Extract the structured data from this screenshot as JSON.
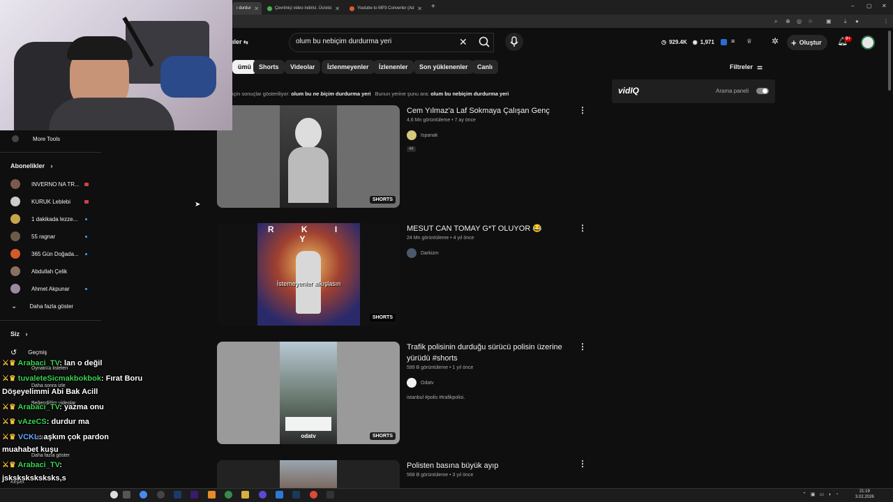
{
  "browser": {
    "tabs": [
      {
        "title": "ı durdur",
        "active": true
      },
      {
        "title": "Çevrimiçi video indirici. Ücretsi",
        "active": false
      },
      {
        "title": "Youtube to MP3 Converter (Ad",
        "active": false
      }
    ],
    "new_tab": "+",
    "window_controls": [
      "–",
      "▢",
      "✕"
    ]
  },
  "youtube": {
    "search": {
      "query": "olum bu nebiçim durdurma yeri",
      "clear_icon": "close-icon",
      "search_icon": "search-icon",
      "mic_icon": "mic-icon"
    },
    "filter_left": "ıler",
    "stats": {
      "views": "929.4K",
      "subs": "1,971"
    },
    "create_label": "Oluştur",
    "notif_badge": "9+",
    "chips": [
      "ümü",
      "Shorts",
      "Videolar",
      "İzlenmeyenler",
      "İzlenenler",
      "Son yüklenenler",
      "Canlı"
    ],
    "filters_label": "Filtreler",
    "correction": {
      "prefix": "için sonuçlar gösteriliyor:",
      "corrected_a": "olum bu",
      "corrected_b": "ne biçim",
      "corrected_c": "durdurma yeri",
      "instead": "Bunun yerine şunu ara:",
      "original": "olum bu nebiçim durdurma yeri"
    },
    "vidiq": {
      "brand": "vidIQ",
      "panel_label": "Arama paneli"
    },
    "results": [
      {
        "title": "Cem Yılmaz'a Laf Sokmaya Çalışan Genç",
        "meta": "4,6 Mn görüntüleme • 7 ay önce",
        "channel": "Ispanak",
        "badge": "4K",
        "shorts": "SHORTS",
        "desc": ""
      },
      {
        "title": "MESUT CAN TOMAY G*T OLUYOR 😂",
        "meta": "24 Mn görüntüleme • 4 yıl önce",
        "channel": "Darkizm",
        "badge": "",
        "shorts": "SHORTS",
        "desc": "",
        "thumb_text": "İstemeyenler alkışlasın",
        "thumb_top": "R K I Y"
      },
      {
        "title": "Trafik polisinin durduğu sürücü polisin üzerine yürüdü #shorts",
        "meta": "599 B görüntüleme • 1 yıl önce",
        "channel": "Odatv",
        "badge": "",
        "shorts": "SHORTS",
        "desc": "istanbul #polis #trafikpolisi.",
        "thumb_text": "odatv"
      },
      {
        "title": "Polisten basına büyük ayıp",
        "meta": "568 B görüntüleme • 3 yıl önce",
        "channel": "",
        "badge": "",
        "shorts": "",
        "desc": ""
      }
    ]
  },
  "sidebar": {
    "more_tools": "More Tools",
    "subs_heading": "Abonelikler",
    "subs": [
      {
        "name": "INVERNO NA TR...",
        "color": "#7a5a4a",
        "mark": "live"
      },
      {
        "name": "KURUK Leblebi",
        "color": "#cccccc",
        "mark": "live"
      },
      {
        "name": "1 dakikada lezze...",
        "color": "#c9a54a",
        "mark": "dot"
      },
      {
        "name": "55 ragnar",
        "color": "#6b5a4a",
        "mark": "dot"
      },
      {
        "name": "365 Gün Doğada...",
        "color": "#d55a2a",
        "mark": "dot"
      },
      {
        "name": "Abdullah Çelik",
        "color": "#8a7060",
        "mark": ""
      },
      {
        "name": "Ahmet Akpunar",
        "color": "#9a8aa0",
        "mark": "dot"
      }
    ],
    "show_more": "Daha fazla göster",
    "you_heading": "Siz",
    "history": "Geçmiş",
    "dim_items": [
      "Oynatma listeleri",
      "Daha sonra izle",
      "Beğendiğim videolar",
      "İndirilenler",
      "Daha fazla göster",
      "Keşfet"
    ]
  },
  "chat": [
    {
      "user": "Arabaci_TV",
      "text": ": lan o değil",
      "color": "g"
    },
    {
      "user": "tuvaleteSicmakbokbok",
      "text": ": Fırat Boru",
      "color": "g"
    },
    {
      "user": "",
      "text": "Döşeyelimmi Abi Bak Acill",
      "color": ""
    },
    {
      "user": "Arabaci_TV",
      "text": ": yazma onu",
      "color": "g"
    },
    {
      "user": "vAzeCS",
      "text": ": durdur ma",
      "color": "g"
    },
    {
      "user": "VCKL",
      "text": ": aşkım çok pardon",
      "color": "b"
    },
    {
      "user": "",
      "text": "muahabet kuşu",
      "color": ""
    },
    {
      "user": "Arabaci_TV",
      "text": ":",
      "color": "g"
    },
    {
      "user": "",
      "text": "jsksksksksksks,s",
      "color": ""
    },
    {
      "user": "Arabaci_TV",
      "text": ":",
      "color": "g"
    }
  ],
  "taskbar": {
    "time": "21:19",
    "date": "3.02.2026"
  },
  "colors": {
    "bg": "#0f0f0f",
    "chip": "#272727",
    "accent": "#3ea6ff",
    "vidiq": "#1f1f1f",
    "notif": "#cc0000"
  }
}
